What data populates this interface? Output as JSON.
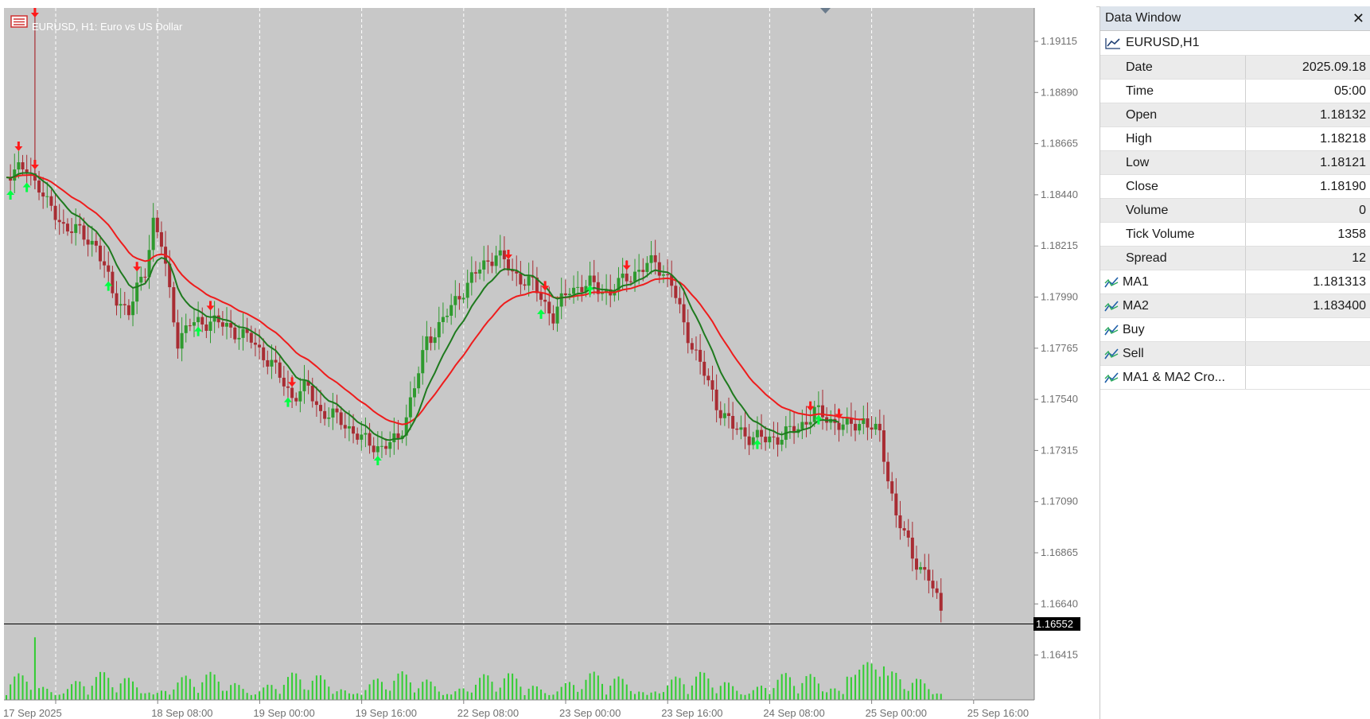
{
  "chart": {
    "title": "EURUSD, H1:  Euro vs US Dollar",
    "current_price": "1.16552",
    "colors": {
      "background": "#c8c8c8",
      "bull": "#2e9a2e",
      "bear": "#a82c33",
      "ma_fast": "#1e7a1e",
      "ma_slow": "#ee1c1c",
      "volume": "#32cd32",
      "buy_arrow": "#00ff44",
      "sell_arrow": "#ff1a1a",
      "grid": "#ffffff"
    },
    "icons": {
      "title": "chart-bars-icon",
      "scroll": "triangle-down-icon"
    },
    "price_axis": [
      "1.19115",
      "1.18890",
      "1.18665",
      "1.18440",
      "1.18215",
      "1.17990",
      "1.17765",
      "1.17540",
      "1.17315",
      "1.17090",
      "1.16865",
      "1.16640",
      "1.16415"
    ],
    "time_axis": [
      "17 Sep 2025",
      "18 Sep 08:00",
      "19 Sep 00:00",
      "19 Sep 16:00",
      "22 Sep 08:00",
      "23 Sep 00:00",
      "23 Sep 16:00",
      "24 Sep 08:00",
      "25 Sep 00:00",
      "25 Sep 16:00"
    ]
  },
  "data_window": {
    "title": "Data Window",
    "close_icon": "close-icon",
    "symbol": "EURUSD,H1",
    "symbol_icon": "line-chart-icon",
    "rows": [
      {
        "key": "Date",
        "value": "2025.09.18"
      },
      {
        "key": "Time",
        "value": "05:00"
      },
      {
        "key": "Open",
        "value": "1.18132"
      },
      {
        "key": "High",
        "value": "1.18218"
      },
      {
        "key": "Low",
        "value": "1.18121"
      },
      {
        "key": "Close",
        "value": "1.18190"
      },
      {
        "key": "Volume",
        "value": "0"
      },
      {
        "key": "Tick Volume",
        "value": "1358"
      },
      {
        "key": "Spread",
        "value": "12"
      }
    ],
    "indicator_icon": "indicator-icon",
    "indicators": [
      {
        "key": "MA1",
        "value": "1.181313"
      },
      {
        "key": "MA2",
        "value": "1.183400"
      },
      {
        "key": "Buy",
        "value": ""
      },
      {
        "key": "Sell",
        "value": ""
      },
      {
        "key": "MA1 & MA2 Cro...",
        "value": ""
      }
    ]
  }
}
